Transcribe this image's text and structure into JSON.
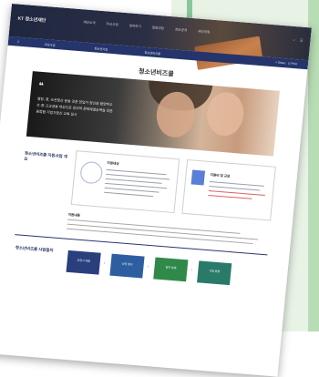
{
  "header": {
    "logo": "KT 청소년재단",
    "nav": [
      "재단소개",
      "주요사업",
      "참여하기",
      "알림마당",
      "정보공개",
      "재단후원"
    ],
    "icons": [
      "search-icon",
      "menu-icon"
    ]
  },
  "subnav": {
    "home_icon": "⌂",
    "crumbs": [
      "주요사업",
      "청소년사업",
      "청소년비즈쿨"
    ],
    "share": "Share",
    "print": "Print"
  },
  "page": {
    "title": "청소년비즈쿨"
  },
  "hero": {
    "quote_mark": "❝",
    "lines": [
      "열정, 꿈, 도전정신 등을 갖춘 창업가 정신을 함양하고",
      "초·중·고교생을 대상으로 창의적 문제해결능력을 갖춘",
      "융합형 기업가정신 교육 실시"
    ]
  },
  "section1": {
    "title": "청소년비즈쿨 지원사업 개요",
    "box1": {
      "title": "지원대상"
    },
    "box2": {
      "title": "지원비 및 규모"
    }
  },
  "note": {
    "title": "지원내용"
  },
  "section2": {
    "title": "청소년비즈쿨 사업절차",
    "steps": [
      {
        "label": "신청서 제출",
        "color": "#2a3f7e"
      },
      {
        "label": "선정 평가",
        "color": "#2d5fa0"
      },
      {
        "label": "협약 체결",
        "color": "#2f8a4a"
      },
      {
        "label": "사업 운영",
        "color": "#2a7a6a"
      }
    ]
  }
}
